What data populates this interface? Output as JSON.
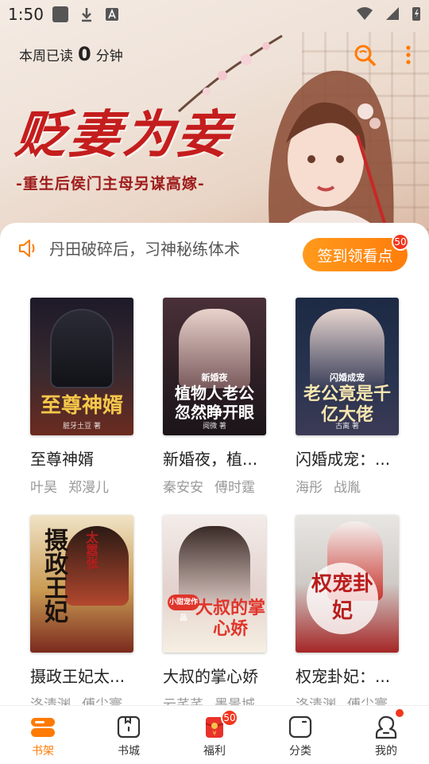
{
  "status_bar": {
    "time": "1:50"
  },
  "header": {
    "reading_label": "本周已读",
    "reading_value": "0",
    "reading_unit": "分钟"
  },
  "banner": {
    "title": "贬妻为妾",
    "subtitle": "-重生后侯门主母另谋高嫁-"
  },
  "notice": {
    "text": "丹田破碎后，习神秘练体术"
  },
  "signin": {
    "label": "签到领看点",
    "badge": "50"
  },
  "books": [
    {
      "title": "至尊神婿",
      "authors": [
        "叶昊",
        "郑漫儿"
      ],
      "cover_title": "至尊神婿",
      "cover_author": "脏牙土豆 著"
    },
    {
      "title": "新婚夜，植...",
      "authors": [
        "秦安安",
        "傅时霆"
      ],
      "cover_title": "植物人老公忽然睁开眼",
      "cover_tag": "新婚夜",
      "cover_author": "阅微 著"
    },
    {
      "title": "闪婚成宠：...",
      "authors": [
        "海彤",
        "战胤"
      ],
      "cover_title": "老公竟是千亿大佬",
      "cover_tag": "闪婚成宠",
      "cover_author": "古离 著"
    },
    {
      "title": "摄政王妃太...",
      "authors": [
        "洛清渊",
        "傅尘寰"
      ],
      "cover_title": "摄政王妃",
      "cover_tag": "太嚣张",
      "cover_author": ""
    },
    {
      "title": "大叔的掌心娇",
      "authors": [
        "云芊芊",
        "墨景城"
      ],
      "cover_title": "大叔的掌心娇",
      "cover_tag": "小甜宠作品",
      "cover_author": ""
    },
    {
      "title": "权宠卦妃：...",
      "authors": [
        "洛清渊",
        "傅尘寰"
      ],
      "cover_title": "权宠卦妃",
      "cover_tag": "",
      "cover_author": ""
    }
  ],
  "bottom_nav": [
    {
      "label": "书架",
      "icon": "bookshelf-icon",
      "active": true
    },
    {
      "label": "书城",
      "icon": "bookstore-icon",
      "active": false
    },
    {
      "label": "福利",
      "icon": "redpacket-icon",
      "active": false,
      "badge": "50"
    },
    {
      "label": "分类",
      "icon": "category-icon",
      "active": false
    },
    {
      "label": "我的",
      "icon": "profile-icon",
      "active": false,
      "dot": true
    }
  ],
  "colors": {
    "accent": "#ff7a00",
    "badge": "#f1361d",
    "title_red": "#c41d1d"
  }
}
